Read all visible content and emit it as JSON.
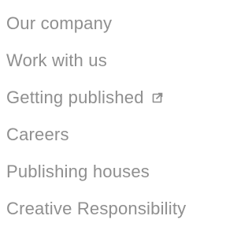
{
  "nav": {
    "items": [
      {
        "label": "Our company",
        "external": false
      },
      {
        "label": "Work with us",
        "external": false
      },
      {
        "label": "Getting published",
        "external": true,
        "icon": "external-link-icon"
      },
      {
        "label": "Careers",
        "external": false
      },
      {
        "label": "Publishing houses",
        "external": false
      },
      {
        "label": "Creative Responsibility",
        "external": false
      }
    ]
  },
  "colors": {
    "text": "#8f8f8f",
    "background": "#ffffff"
  }
}
